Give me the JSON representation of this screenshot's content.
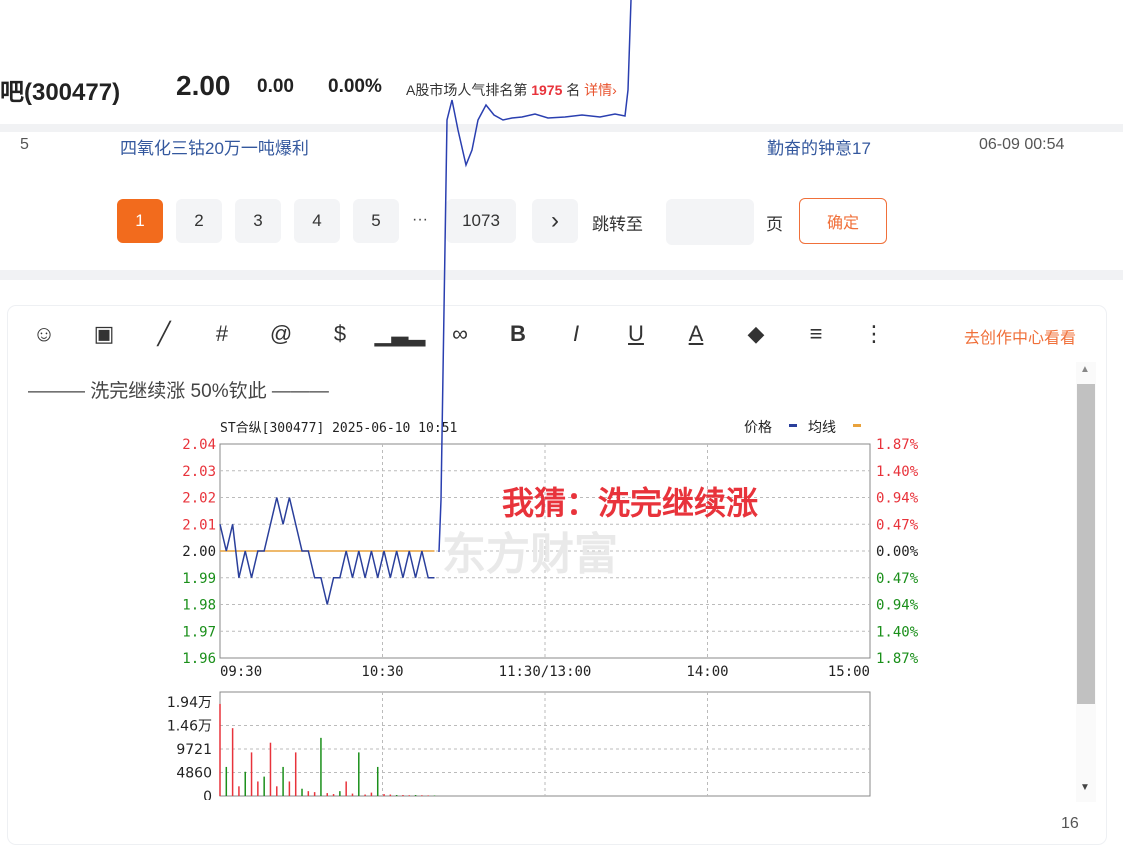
{
  "header": {
    "name": "吧(300477)",
    "price": "2.00",
    "change": "0.00",
    "change_pct": "0.00%",
    "rank_prefix": "A股市场人气排名第",
    "rank_num": "1975",
    "rank_suffix": "名",
    "detail": "详情›"
  },
  "post_row": {
    "index": "5",
    "title": "四氧化三钴20万一吨爆利",
    "author": "勤奋的钟意17",
    "time": "06-09 00:54"
  },
  "pagination": {
    "pages": [
      "1",
      "2",
      "3",
      "4",
      "5"
    ],
    "ellipsis": "···",
    "last": "1073",
    "next": "›",
    "jump_label": "跳转至",
    "page_unit": "页",
    "confirm": "确定"
  },
  "editor": {
    "toolbar_icons": [
      "emoji-icon",
      "image-icon",
      "line-chart-icon",
      "hashtag-icon",
      "mention-icon",
      "dollar-icon",
      "bar-chart-icon",
      "link-icon",
      "bold-icon",
      "italic-icon",
      "underline-icon",
      "font-color-icon",
      "eraser-icon",
      "align-icon",
      "more-icon"
    ],
    "toolbar_glyphs": [
      "☺",
      "▣",
      "╱",
      "#",
      "@",
      "$",
      "▁▃▂",
      "∞",
      "B",
      "I",
      "U",
      "A",
      "◆",
      "≡",
      "⋮"
    ],
    "creator_link": "去创作中心看看",
    "quote": "——— 洗完继续涨 50%钦此 ———",
    "char_count": "16"
  },
  "chart_data": {
    "type": "line",
    "title": "ST合纵[300477] 2025-06-10 10:51",
    "legend": [
      "价格",
      "均线"
    ],
    "annotation": "我猜：洗完继续涨",
    "watermark": "东方财富",
    "x_ticks": [
      "09:30",
      "10:30",
      "11:30/13:00",
      "14:00",
      "15:00"
    ],
    "y_ticks": [
      "2.04",
      "2.03",
      "2.02",
      "2.01",
      "2.00",
      "1.99",
      "1.98",
      "1.97",
      "1.96"
    ],
    "y_right_ticks": [
      "1.87%",
      "1.40%",
      "0.94%",
      "0.47%",
      "0.00%",
      "0.47%",
      "0.94%",
      "1.40%",
      "1.87%"
    ],
    "ylim": [
      1.96,
      2.04
    ],
    "price_series": [
      2.01,
      2.0,
      2.01,
      1.99,
      2.0,
      1.99,
      2.0,
      2.0,
      2.01,
      2.02,
      2.01,
      2.02,
      2.01,
      2.0,
      2.0,
      1.99,
      1.99,
      1.98,
      1.99,
      1.99,
      2.0,
      1.99,
      2.0,
      1.99,
      2.0,
      1.99,
      2.0,
      1.99,
      2.0,
      1.99,
      2.0,
      1.99,
      2.0,
      1.99,
      1.99
    ],
    "avg_series": [
      2.0,
      2.0,
      2.0,
      2.0,
      2.0,
      2.0,
      2.0,
      2.0,
      2.0,
      2.0,
      2.0,
      2.0,
      2.0,
      2.0,
      2.0,
      2.0,
      2.0,
      2.0,
      2.0,
      2.0,
      2.0,
      2.0,
      2.0,
      2.0,
      2.0,
      2.0,
      2.0,
      2.0,
      2.0,
      2.0,
      2.0,
      2.0,
      2.0,
      2.0,
      2.0
    ],
    "volume_ticks": [
      "1.94万",
      "1.46万",
      "9721",
      "4860",
      "0"
    ],
    "volume_max": 19400,
    "volume_series": [
      19000,
      6000,
      14000,
      2000,
      5000,
      9000,
      3000,
      4000,
      11000,
      2000,
      6000,
      3000,
      9000,
      1500,
      1000,
      800,
      12000,
      600,
      400,
      1000,
      3000,
      500,
      9000,
      300,
      700,
      6000,
      400,
      300,
      200,
      200,
      150,
      200,
      150,
      120,
      100
    ],
    "colors": {
      "price": "#2a3f9b",
      "avg": "#e9a23b",
      "up": "#e8333b",
      "down": "#1a8f1a",
      "annotation": "#e8333b"
    }
  }
}
